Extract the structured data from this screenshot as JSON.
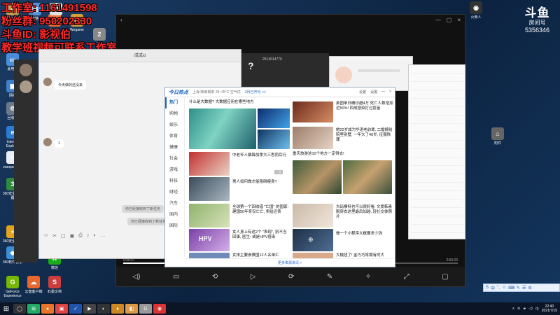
{
  "overlay": {
    "line0": "工作室: 1161491598",
    "line1": "粉丝群: 950202330",
    "line2": "斗鱼ID: 影视伯",
    "line3": "教学班视频可联系工作室"
  },
  "douyu": {
    "logo": "斗鱼",
    "sub": "房间号",
    "room": "5356346"
  },
  "desktop_icons": [
    {
      "label": "Administ...",
      "glyph": "A",
      "color": "#c89f54"
    },
    {
      "label": "此电脑",
      "glyph": "▭",
      "color": "#4a8ed9"
    },
    {
      "label": "网络",
      "glyph": "▣",
      "color": "#3f7fc9"
    },
    {
      "label": "回收站",
      "glyph": "♲",
      "color": "#6a7a8a"
    },
    {
      "label": "Internet Explorer",
      "glyph": "e",
      "color": "#2b7cd3"
    },
    {
      "label": "zanquestion",
      "glyph": "≡",
      "color": "#e9eef4"
    },
    {
      "label": "360安全浏览器",
      "glyph": "3",
      "color": "#2e8b3e"
    },
    {
      "label": "360安全卫士",
      "glyph": "+",
      "color": "#e3a31c"
    },
    {
      "label": "360软件管家",
      "glyph": "◆",
      "color": "#3a8fd6"
    },
    {
      "label": "GeForce Experience",
      "glyph": "G",
      "color": "#76b900"
    },
    {
      "label": "云盘客户端",
      "glyph": "☁",
      "color": "#e9662c"
    },
    {
      "label": "微信",
      "glyph": "w",
      "color": "#1aad19"
    },
    {
      "label": "石墨文档",
      "glyph": "S",
      "color": "#cc3d3d"
    },
    {
      "label": "Origin",
      "glyph": "O",
      "color": "#f56c2d"
    },
    {
      "label": "Wegame",
      "glyph": "W",
      "color": "#d4a236"
    },
    {
      "label": "2.0",
      "glyph": "2",
      "color": "#888"
    },
    {
      "label": "电脑",
      "glyph": "▤",
      "color": "#5b8fd0"
    },
    {
      "label": "文档",
      "glyph": "◧",
      "color": "#e0e0e0"
    }
  ],
  "right_desktop_icons": [
    {
      "label": "火柴人",
      "glyph": "◉",
      "color": "#333"
    },
    {
      "label": "附件",
      "glyph": "⌂",
      "color": "#666"
    }
  ],
  "player": {
    "title": "",
    "controls": [
      "◁)",
      "▭",
      "⟲",
      "▷",
      "⟳",
      "✎",
      "✧",
      "⤢",
      "▢"
    ],
    "time_left": "0:06:57",
    "time_right": "2:50:23"
  },
  "qq_chat": {
    "title": "成成xi",
    "messages": [
      {
        "text": "今天做的还没来"
      },
      {
        "text": "1"
      }
    ],
    "system1": "你已经接收到了新任务",
    "system2": "你已经接收到了新任务",
    "tools": [
      "☺",
      "✂",
      "▢",
      "▣",
      "⎙",
      "♪",
      "◐",
      "…"
    ]
  },
  "call_window": {
    "glyph": "?",
    "number": "2514014770"
  },
  "news": {
    "brand": "今日热点",
    "weather": "上海 降雨概率 28~35°C 空气优",
    "weather_link": "3月已开元 >>",
    "actions": [
      "设置",
      "设置",
      "—",
      "×"
    ],
    "nav": [
      "热门",
      "购物",
      "娱乐",
      "体育",
      "健康",
      "社会",
      "游戏",
      "科技",
      "财经",
      "汽车",
      "国内",
      "国际"
    ],
    "headline1": "什么是大数据? 大数据应用在哪些地方",
    "headline2": "英国单日确诊超4万 死亡人数增加近50%! 四成感染打过疫苗",
    "headline3": "她22岁成为华语老前辈, 二婚嫁给院里别墅, 一年大了40岁, 征服陈珊",
    "headline4": "中老年人暴躁加拿大三思而后行",
    "headline5": "重庆旅游这10个地方一定得去!",
    "headline6": "男人如何做才能阻碍瘦身?",
    "headline7": "全球第一个回收借 \"亡国\" 的国家: 建国50年育仅亡亡, 卖给还债",
    "headline8": "大码模特也可以很好看, 文爱韩素服穿衣这里最后加越, 轻社交体照片",
    "headline9": "女人身上有这2个 \"表现\", 别不当回事, 医生: 或是HPV感染",
    "headline10": "做一个小程序大概要多少钱",
    "headline11": "女排主要参赛国12人名单汇",
    "headline12": "大输扭了! 金巧巧将拥有的大",
    "ad_tag": "广告",
    "footer": "更多来源资讯 >"
  },
  "taskbar": {
    "start": "⊞",
    "apps": [
      {
        "glyph": "◯",
        "color": "#333"
      },
      {
        "glyph": "⊞",
        "color": "#2a6"
      },
      {
        "glyph": "●",
        "color": "#e8752a"
      },
      {
        "glyph": "▣",
        "color": "#d44"
      },
      {
        "glyph": "✓",
        "color": "#25a"
      },
      {
        "glyph": "▶",
        "color": "#444"
      },
      {
        "glyph": "◐",
        "color": "#333"
      },
      {
        "glyph": "♦",
        "color": "#c82"
      },
      {
        "glyph": "◧",
        "color": "#d94"
      },
      {
        "glyph": "G",
        "color": "#999"
      },
      {
        "glyph": "◉",
        "color": "#d33"
      }
    ],
    "tray_icons": [
      "∧",
      "⊚",
      "▰",
      "◁)",
      "中"
    ],
    "time": "22:40",
    "date": "2021/7/15"
  },
  "ime": {
    "items": [
      "S",
      "中",
      "°,",
      "☺",
      "⌨",
      "✎",
      "☰",
      "⚙"
    ]
  }
}
